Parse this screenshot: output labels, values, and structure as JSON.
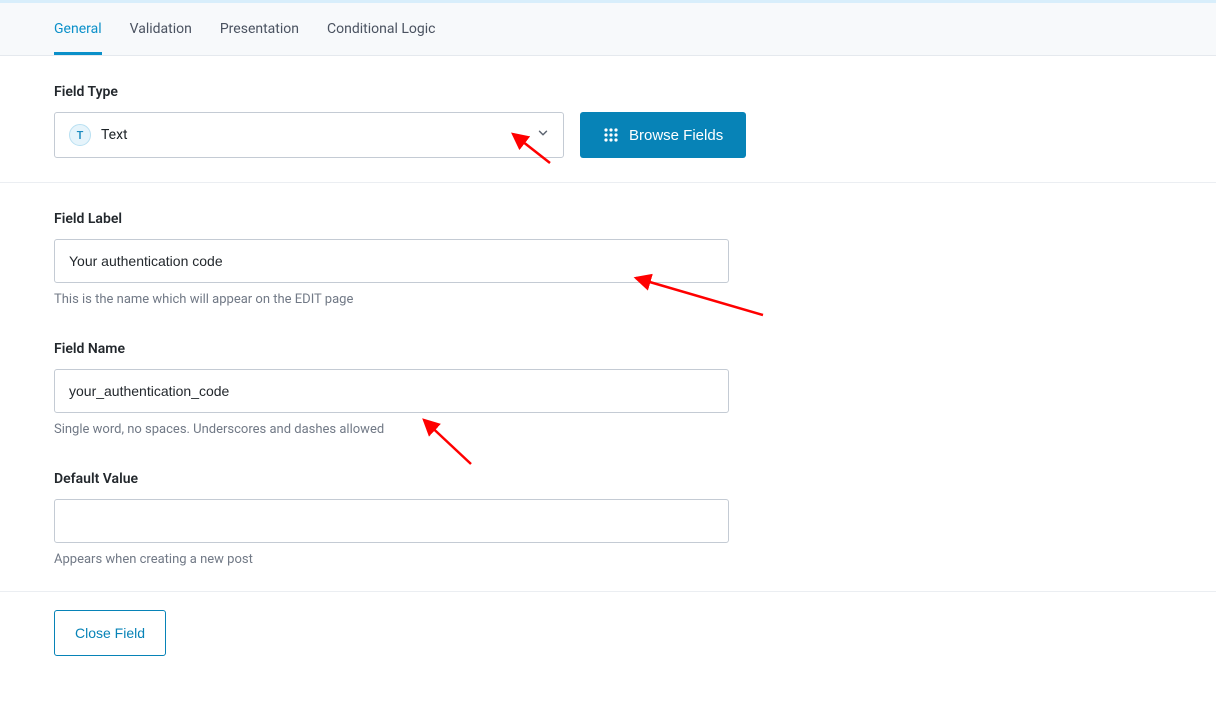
{
  "tabs": {
    "general": "General",
    "validation": "Validation",
    "presentation": "Presentation",
    "conditional_logic": "Conditional Logic"
  },
  "field_type": {
    "label": "Field Type",
    "badge_letter": "T",
    "selected": "Text",
    "browse_button": "Browse Fields"
  },
  "field_label": {
    "label": "Field Label",
    "value": "Your authentication code",
    "hint": "This is the name which will appear on the EDIT page"
  },
  "field_name": {
    "label": "Field Name",
    "value": "your_authentication_code",
    "hint": "Single word, no spaces. Underscores and dashes allowed"
  },
  "default_value": {
    "label": "Default Value",
    "value": "",
    "hint": "Appears when creating a new post"
  },
  "footer": {
    "close_button": "Close Field"
  }
}
